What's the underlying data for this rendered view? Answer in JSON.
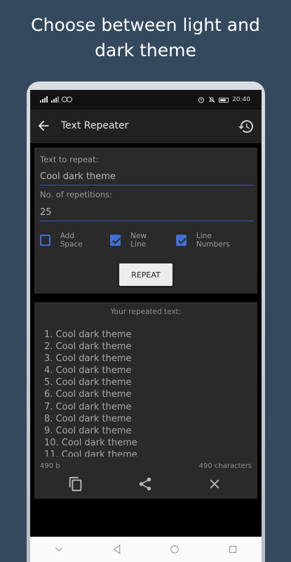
{
  "headline": {
    "line1": "Choose between light and",
    "line2": "dark theme"
  },
  "statusbar": {
    "time": "20:40",
    "left_icons": "ᴴᴵ .ıl .ıl"
  },
  "appbar": {
    "title": "Text Repeater",
    "back_icon": "arrow-left-icon",
    "history_icon": "history-icon"
  },
  "form": {
    "text_label": "Text to repeat:",
    "text_value": "Cool dark theme",
    "count_label": "No. of repetitions:",
    "count_value": "25",
    "options": [
      {
        "label": "Add Space",
        "checked": false
      },
      {
        "label": "New Line",
        "checked": true
      },
      {
        "label": "Line Numbers",
        "checked": true
      }
    ],
    "repeat_label": "REPEAT"
  },
  "result": {
    "title": "Your repeated text:",
    "lines": [
      "1. Cool dark theme",
      "2. Cool dark theme",
      "3. Cool dark theme",
      "4. Cool dark theme",
      "5. Cool dark theme",
      "6. Cool dark theme",
      "7. Cool dark theme",
      "8. Cool dark theme",
      "9. Cool dark theme",
      "10. Cool dark theme",
      "11. Cool dark theme"
    ],
    "size": "490 b",
    "characters": "490 characters"
  },
  "colors": {
    "background": "#34495e",
    "accent": "#3f6fd6",
    "card": "#2a2a2a",
    "appbar": "#212121"
  }
}
